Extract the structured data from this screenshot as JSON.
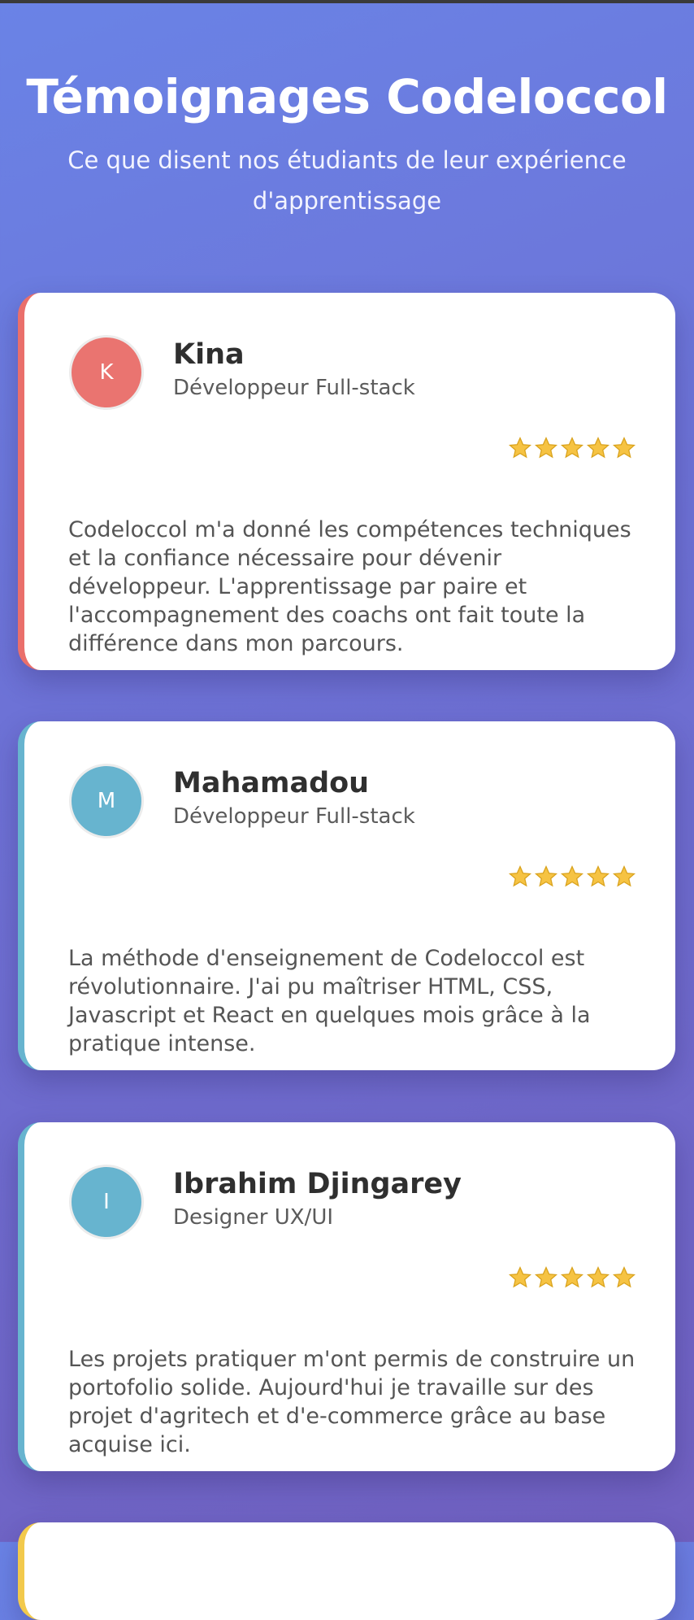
{
  "page": {
    "title": "Témoignages Codeloccol",
    "subtitle": "Ce que disent nos étudiants de leur expérience d'apprentissage"
  },
  "colors": {
    "background_start": "#6a83e6",
    "background_end": "#7060c0",
    "accent_red": "#ea6f6b",
    "accent_blue": "#67b4cf",
    "accent_yellow": "#f2c94c",
    "star": "#f6c343"
  },
  "testimonials": [
    {
      "initial": "K",
      "name": "Kina",
      "role": "Développeur Full-stack",
      "rating": 5,
      "avatar_color": "#ea7470",
      "quote": "Codeloccol m'a donné les compétences techniques et la confiance nécessaire pour dévenir développeur. L'apprentissage par paire et l'accompagnement des coachs ont fait toute la différence dans mon parcours."
    },
    {
      "initial": "M",
      "name": "Mahamadou",
      "role": "Développeur Full-stack",
      "rating": 5,
      "avatar_color": "#67b4cf",
      "quote": "La méthode d'enseignement de Codeloccol est révolutionnaire. J'ai pu maîtriser HTML, CSS, Javascript et React en quelques mois grâce à la pratique intense."
    },
    {
      "initial": "I",
      "name": "Ibrahim Djingarey",
      "role": "Designer UX/UI",
      "rating": 5,
      "avatar_color": "#67b4cf",
      "quote": "Les projets pratiquer m'ont permis de construire un portofolio solide. Aujourd'hui je travaille sur des projet d'agritech et d'e-commerce grâce au base acquise ici."
    }
  ]
}
